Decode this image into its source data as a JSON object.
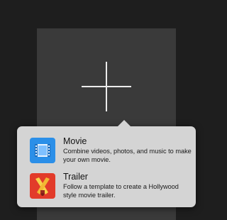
{
  "create_tile": {
    "action": "Create New"
  },
  "menu": {
    "items": [
      {
        "title": "Movie",
        "description": "Combine videos, photos, and music to make your own movie.",
        "icon": "film-strip-icon",
        "icon_color": "#2b8fe8"
      },
      {
        "title": "Trailer",
        "description": "Follow a template to create a Hollywood style movie trailer.",
        "icon": "crossed-spotlights-icon",
        "icon_color": "#e23b2a"
      }
    ]
  },
  "colors": {
    "background": "#1e1e1e",
    "tile": "#3a3a3a",
    "popover": "#d4d4d4"
  }
}
